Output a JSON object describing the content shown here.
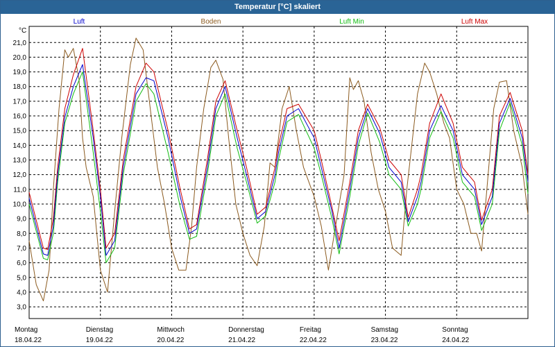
{
  "window": {
    "title": "Temperatur [°C] skaliert"
  },
  "chart_data": {
    "type": "line",
    "title": "Temperatur [°C] skaliert",
    "ylabel": "°C",
    "ylim": [
      2.2,
      22.1
    ],
    "yticks": [
      "3,0",
      "4,0",
      "5,0",
      "6,0",
      "7,0",
      "8,0",
      "9,0",
      "10,0",
      "11,0",
      "12,0",
      "13,0",
      "14,0",
      "15,0",
      "16,0",
      "17,0",
      "18,0",
      "19,0",
      "20,0",
      "21,0"
    ],
    "ytick_values": [
      3,
      4,
      5,
      6,
      7,
      8,
      9,
      10,
      11,
      12,
      13,
      14,
      15,
      16,
      17,
      18,
      19,
      20,
      21
    ],
    "grid": true,
    "legend_position": "top",
    "days": [
      {
        "weekday": "Montag",
        "date": "18.04.22"
      },
      {
        "weekday": "Dienstag",
        "date": "19.04.22"
      },
      {
        "weekday": "Mittwoch",
        "date": "20.04.22"
      },
      {
        "weekday": "Donnerstag",
        "date": "21.04.22"
      },
      {
        "weekday": "Freitag",
        "date": "22.04.22"
      },
      {
        "weekday": "Samstag",
        "date": "23.04.22"
      },
      {
        "weekday": "Sonntag",
        "date": "24.04.22"
      }
    ],
    "x_unit": "days from 18.04.22 00:00",
    "xlim": [
      0,
      7
    ],
    "series": [
      {
        "name": "Luft",
        "color": "#0000cc",
        "x": [
          0.0,
          0.2,
          0.26,
          0.34,
          0.4,
          0.5,
          0.62,
          0.75,
          0.9,
          1.0,
          1.08,
          1.2,
          1.32,
          1.5,
          1.64,
          1.75,
          1.95,
          2.12,
          2.25,
          2.35,
          2.5,
          2.62,
          2.75,
          2.92,
          3.05,
          3.2,
          3.32,
          3.45,
          3.5,
          3.62,
          3.78,
          4.0,
          4.1,
          4.25,
          4.35,
          4.5,
          4.62,
          4.75,
          4.92,
          5.05,
          5.22,
          5.32,
          5.45,
          5.5,
          5.62,
          5.78,
          5.95,
          6.08,
          6.25,
          6.35,
          6.5,
          6.6,
          6.75,
          6.92,
          7.0
        ],
        "y": [
          10.4,
          6.6,
          6.5,
          8.5,
          12.0,
          15.9,
          18.0,
          19.5,
          14.5,
          10.5,
          6.5,
          7.5,
          12.5,
          17.5,
          18.6,
          18.4,
          14.5,
          10.5,
          8.0,
          8.3,
          12.5,
          16.5,
          18.0,
          14.5,
          12.0,
          9.0,
          9.5,
          12.0,
          13.5,
          16.0,
          16.5,
          14.5,
          12.5,
          9.5,
          7.0,
          11.0,
          14.5,
          16.5,
          14.8,
          12.5,
          11.5,
          8.8,
          10.5,
          11.5,
          15.0,
          16.7,
          15.0,
          12.0,
          11.0,
          8.6,
          10.5,
          15.5,
          17.2,
          14.5,
          11.5
        ]
      },
      {
        "name": "Boden",
        "color": "#8b5a1e",
        "x": [
          0.0,
          0.1,
          0.2,
          0.28,
          0.34,
          0.42,
          0.5,
          0.55,
          0.62,
          0.7,
          0.75,
          0.8,
          0.9,
          1.0,
          1.1,
          1.2,
          1.3,
          1.42,
          1.5,
          1.6,
          1.7,
          1.8,
          1.9,
          2.0,
          2.1,
          2.2,
          2.28,
          2.35,
          2.45,
          2.55,
          2.62,
          2.72,
          2.8,
          2.9,
          3.0,
          3.1,
          3.2,
          3.3,
          3.38,
          3.45,
          3.55,
          3.65,
          3.75,
          3.85,
          4.0,
          4.1,
          4.2,
          4.3,
          4.42,
          4.5,
          4.55,
          4.62,
          4.7,
          4.8,
          4.9,
          5.0,
          5.1,
          5.22,
          5.3,
          5.45,
          5.55,
          5.62,
          5.72,
          5.82,
          5.9,
          6.0,
          6.1,
          6.2,
          6.28,
          6.35,
          6.45,
          6.52,
          6.6,
          6.7,
          6.8,
          6.92,
          7.0
        ],
        "y": [
          7.5,
          4.5,
          3.4,
          5.5,
          11.0,
          16.5,
          20.5,
          20.0,
          20.6,
          18.5,
          14.5,
          12.5,
          10.5,
          5.5,
          4.0,
          9.5,
          14.5,
          19.5,
          21.3,
          20.5,
          16.5,
          12.5,
          10.0,
          7.0,
          5.5,
          5.5,
          8.5,
          12.5,
          16.5,
          19.3,
          19.8,
          18.5,
          14.5,
          10.0,
          8.0,
          6.5,
          5.8,
          8.5,
          12.8,
          12.5,
          16.5,
          18.0,
          15.0,
          12.5,
          10.5,
          8.5,
          5.5,
          8.5,
          12.0,
          18.6,
          17.8,
          18.4,
          17.0,
          13.5,
          11.0,
          9.5,
          7.0,
          6.5,
          11.0,
          17.5,
          19.6,
          19.0,
          17.5,
          15.5,
          14.5,
          11.0,
          10.0,
          8.0,
          8.0,
          6.8,
          12.5,
          16.5,
          18.3,
          18.4,
          15.0,
          12.5,
          9.3
        ]
      },
      {
        "name": "Luft Min",
        "color": "#11bb11",
        "x": [
          0.0,
          0.2,
          0.26,
          0.34,
          0.4,
          0.5,
          0.62,
          0.75,
          0.9,
          1.0,
          1.08,
          1.2,
          1.32,
          1.5,
          1.64,
          1.75,
          1.95,
          2.12,
          2.25,
          2.35,
          2.5,
          2.62,
          2.75,
          2.92,
          3.05,
          3.2,
          3.32,
          3.45,
          3.5,
          3.62,
          3.78,
          4.0,
          4.1,
          4.25,
          4.35,
          4.5,
          4.62,
          4.75,
          4.92,
          5.05,
          5.22,
          5.32,
          5.45,
          5.5,
          5.62,
          5.78,
          5.95,
          6.08,
          6.25,
          6.35,
          6.5,
          6.6,
          6.75,
          6.92,
          7.0
        ],
        "y": [
          10.0,
          6.3,
          6.2,
          8.0,
          11.5,
          15.5,
          17.5,
          19.0,
          13.5,
          9.5,
          6.0,
          7.0,
          12.0,
          17.0,
          18.2,
          17.5,
          13.5,
          9.8,
          7.6,
          7.8,
          12.0,
          16.0,
          17.5,
          13.8,
          11.5,
          8.7,
          9.2,
          11.5,
          13.0,
          15.6,
          16.1,
          13.8,
          12.0,
          9.0,
          6.6,
          10.5,
          14.0,
          16.2,
          14.2,
          12.0,
          11.0,
          8.5,
          10.0,
          11.0,
          14.5,
          16.3,
          14.5,
          11.5,
          10.5,
          8.2,
          10.0,
          15.0,
          16.9,
          14.0,
          10.7
        ]
      },
      {
        "name": "Luft Max",
        "color": "#cc0000",
        "x": [
          0.0,
          0.2,
          0.26,
          0.34,
          0.4,
          0.5,
          0.62,
          0.75,
          0.9,
          1.0,
          1.08,
          1.2,
          1.32,
          1.5,
          1.64,
          1.75,
          1.95,
          2.12,
          2.25,
          2.35,
          2.5,
          2.62,
          2.75,
          2.92,
          3.05,
          3.2,
          3.32,
          3.45,
          3.5,
          3.62,
          3.78,
          4.0,
          4.1,
          4.25,
          4.35,
          4.5,
          4.62,
          4.75,
          4.92,
          5.05,
          5.22,
          5.32,
          5.45,
          5.5,
          5.62,
          5.78,
          5.95,
          6.08,
          6.25,
          6.35,
          6.5,
          6.6,
          6.75,
          6.92,
          7.0
        ],
        "y": [
          10.8,
          7.0,
          6.9,
          9.0,
          12.5,
          16.5,
          18.8,
          20.6,
          15.0,
          11.0,
          7.0,
          8.0,
          13.0,
          18.0,
          19.6,
          19.0,
          15.0,
          11.0,
          8.3,
          8.6,
          13.0,
          17.0,
          18.4,
          15.0,
          12.5,
          9.3,
          9.8,
          12.5,
          14.0,
          16.5,
          16.8,
          15.0,
          13.0,
          9.8,
          7.5,
          11.5,
          15.0,
          16.8,
          15.2,
          13.0,
          12.0,
          9.1,
          11.0,
          12.0,
          15.5,
          17.5,
          15.5,
          12.5,
          11.5,
          8.9,
          11.0,
          16.0,
          17.6,
          15.0,
          12.0
        ]
      }
    ]
  }
}
